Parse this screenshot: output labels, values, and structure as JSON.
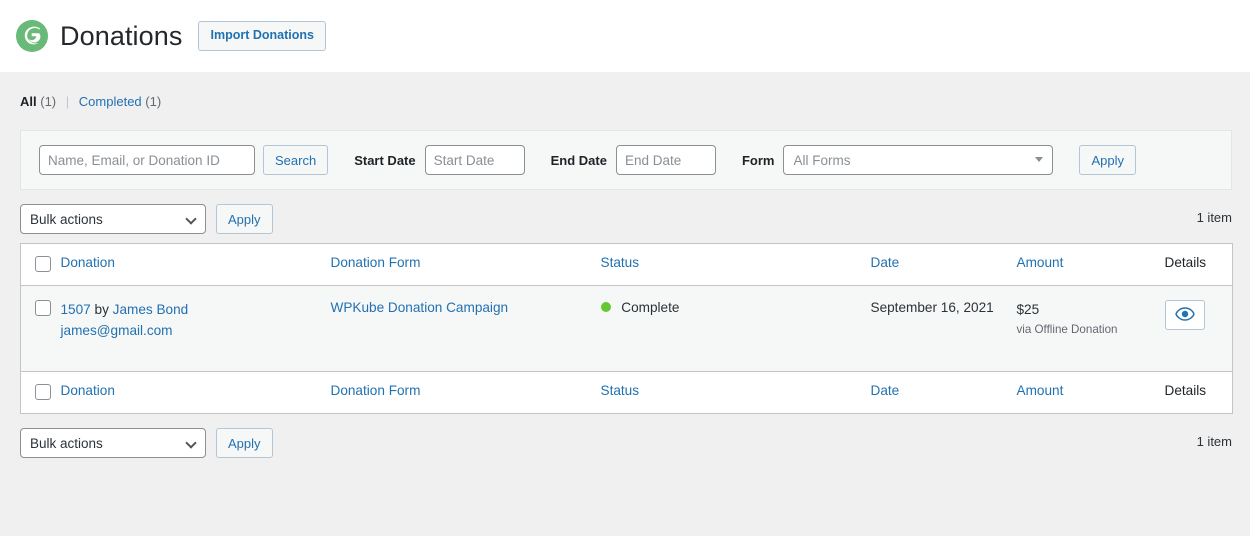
{
  "header": {
    "logo_icon": "givewp-logo-icon",
    "title": "Donations",
    "import_button": "Import Donations"
  },
  "views": {
    "all_label": "All",
    "all_count": "(1)",
    "separator": "|",
    "completed_label": "Completed",
    "completed_count": "(1)"
  },
  "filters": {
    "search_placeholder": "Name, Email, or Donation ID",
    "search_value": "",
    "search_button": "Search",
    "start_date_label": "Start Date",
    "start_date_placeholder": "Start Date",
    "start_date_value": "",
    "end_date_label": "End Date",
    "end_date_placeholder": "End Date",
    "end_date_value": "",
    "form_label": "Form",
    "form_selected": "All Forms",
    "form_dropdown_icon": "triangle-down-icon",
    "apply_button": "Apply"
  },
  "tablenav_top": {
    "bulk_selected": "Bulk actions",
    "bulk_dropdown_icon": "chevron-down-icon",
    "apply_button": "Apply",
    "item_count": "1 item"
  },
  "tablenav_bottom": {
    "bulk_selected": "Bulk actions",
    "bulk_dropdown_icon": "chevron-down-icon",
    "apply_button": "Apply",
    "item_count": "1 item"
  },
  "table": {
    "columns": [
      {
        "key": "donation",
        "label": "Donation",
        "sortable": true
      },
      {
        "key": "form",
        "label": "Donation Form",
        "sortable": true
      },
      {
        "key": "status",
        "label": "Status",
        "sortable": true
      },
      {
        "key": "date",
        "label": "Date",
        "sortable": true
      },
      {
        "key": "amount",
        "label": "Amount",
        "sortable": true
      },
      {
        "key": "details",
        "label": "Details",
        "sortable": false
      }
    ],
    "rows": [
      {
        "donation_id": "1507",
        "donation_by": "by",
        "donor_name": "James Bond",
        "donor_email": "james@gmail.com",
        "form": "WPKube Donation Campaign",
        "status": "Complete",
        "status_color": "#64c832",
        "date": "September 16, 2021",
        "amount": "$25",
        "amount_via": "via Offline Donation",
        "details_icon": "eye-icon"
      }
    ]
  },
  "colors": {
    "link": "#2271b1",
    "page_bg": "#f0f0f1",
    "brand_green": "#69b978",
    "status_green": "#64c832"
  }
}
